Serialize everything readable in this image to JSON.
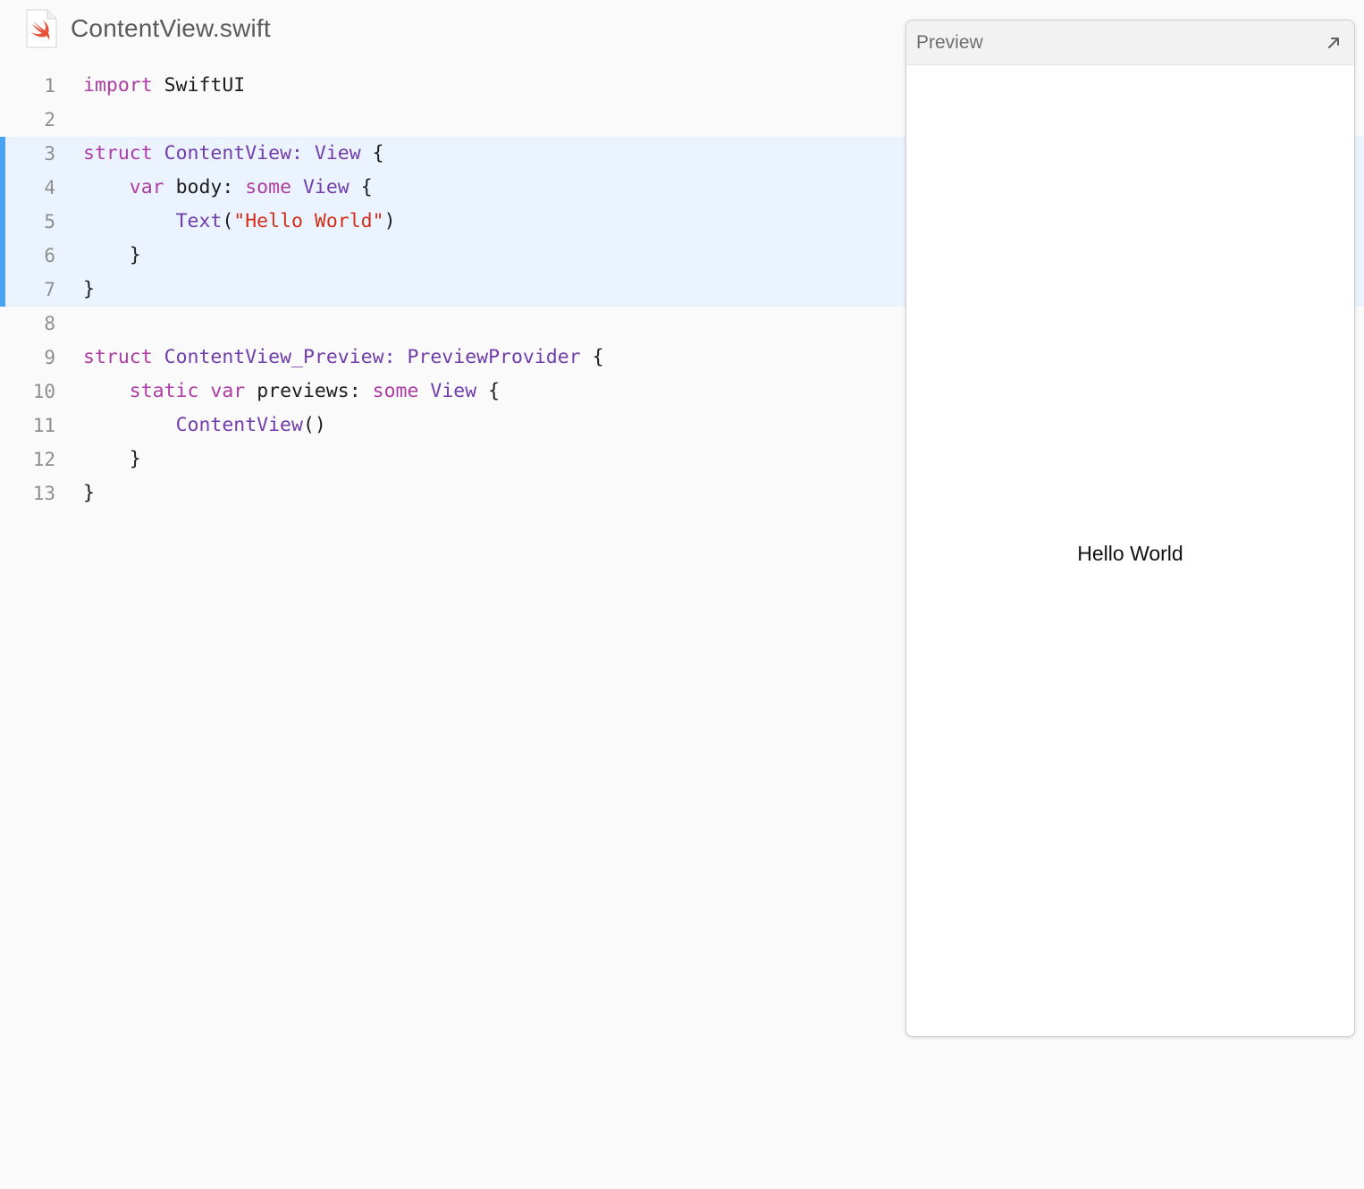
{
  "file": {
    "icon": "swift-file-icon",
    "name": "ContentView.swift"
  },
  "editor": {
    "highlighted_lines": [
      3,
      4,
      5,
      6,
      7
    ],
    "lines": [
      {
        "num": "1",
        "tokens": [
          {
            "t": "import",
            "c": "kw"
          },
          {
            "t": " SwiftUI",
            "c": "pn"
          }
        ]
      },
      {
        "num": "2",
        "tokens": []
      },
      {
        "num": "3",
        "tokens": [
          {
            "t": "struct",
            "c": "kw"
          },
          {
            "t": " ",
            "c": "pn"
          },
          {
            "t": "ContentView",
            "c": "ty"
          },
          {
            "t": ": ",
            "c": "ty"
          },
          {
            "t": "View",
            "c": "ty"
          },
          {
            "t": " {",
            "c": "pn"
          }
        ]
      },
      {
        "num": "4",
        "tokens": [
          {
            "t": "    ",
            "c": "pn"
          },
          {
            "t": "var",
            "c": "kw"
          },
          {
            "t": " body: ",
            "c": "pn"
          },
          {
            "t": "some",
            "c": "kw"
          },
          {
            "t": " ",
            "c": "pn"
          },
          {
            "t": "View",
            "c": "ty"
          },
          {
            "t": " {",
            "c": "pn"
          }
        ]
      },
      {
        "num": "5",
        "tokens": [
          {
            "t": "        ",
            "c": "pn"
          },
          {
            "t": "Text",
            "c": "ty"
          },
          {
            "t": "(",
            "c": "pn"
          },
          {
            "t": "\"Hello World\"",
            "c": "st"
          },
          {
            "t": ")",
            "c": "pn"
          }
        ]
      },
      {
        "num": "6",
        "tokens": [
          {
            "t": "    }",
            "c": "pn"
          }
        ]
      },
      {
        "num": "7",
        "tokens": [
          {
            "t": "}",
            "c": "pn"
          }
        ]
      },
      {
        "num": "8",
        "tokens": []
      },
      {
        "num": "9",
        "tokens": [
          {
            "t": "struct",
            "c": "kw"
          },
          {
            "t": " ",
            "c": "pn"
          },
          {
            "t": "ContentView_Preview",
            "c": "ty"
          },
          {
            "t": ": ",
            "c": "ty"
          },
          {
            "t": "PreviewProvider",
            "c": "ty"
          },
          {
            "t": " {",
            "c": "pn"
          }
        ]
      },
      {
        "num": "10",
        "tokens": [
          {
            "t": "    ",
            "c": "pn"
          },
          {
            "t": "static",
            "c": "kw"
          },
          {
            "t": " ",
            "c": "pn"
          },
          {
            "t": "var",
            "c": "kw"
          },
          {
            "t": " previews: ",
            "c": "pn"
          },
          {
            "t": "some",
            "c": "kw"
          },
          {
            "t": " ",
            "c": "pn"
          },
          {
            "t": "View",
            "c": "ty"
          },
          {
            "t": " {",
            "c": "pn"
          }
        ]
      },
      {
        "num": "11",
        "tokens": [
          {
            "t": "        ",
            "c": "pn"
          },
          {
            "t": "ContentView",
            "c": "ty"
          },
          {
            "t": "()",
            "c": "pn"
          }
        ]
      },
      {
        "num": "12",
        "tokens": [
          {
            "t": "    }",
            "c": "pn"
          }
        ]
      },
      {
        "num": "13",
        "tokens": [
          {
            "t": "}",
            "c": "pn"
          }
        ]
      }
    ]
  },
  "preview": {
    "title": "Preview",
    "expand_icon": "expand-arrow-icon",
    "content_text": "Hello World"
  },
  "colors": {
    "keyword": "#ad3da4",
    "type": "#703daa",
    "string": "#d12f1b",
    "highlight_bg": "#ebf4fe",
    "highlight_bar": "#4aa3f0"
  }
}
